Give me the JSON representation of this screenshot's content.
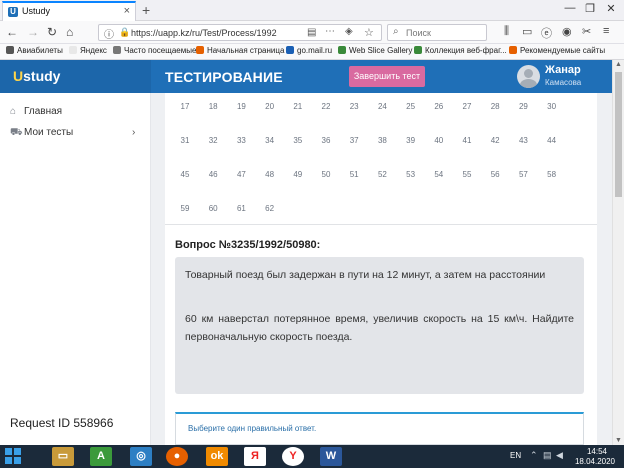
{
  "browser": {
    "tab_title": "Ustudy",
    "url": "https://uapp.kz/ru/Test/Process/1992",
    "search_placeholder": "Поиск",
    "bookmarks": [
      {
        "label": "Авиабилеты",
        "color": "#555555"
      },
      {
        "label": "Яндекс",
        "color": "#e8e8e8"
      },
      {
        "label": "Часто посещаемые",
        "color": "#777777"
      },
      {
        "label": "Начальная страница",
        "color": "#e66000"
      },
      {
        "label": "go.mail.ru",
        "color": "#1a5fb4"
      },
      {
        "label": "Web Slice Gallery",
        "color": "#3a8a3a"
      },
      {
        "label": "Коллекция веб-фраг...",
        "color": "#3a8a3a"
      },
      {
        "label": "Рекомендуемые сайты",
        "color": "#e66000"
      }
    ]
  },
  "header": {
    "logo_initial": "U",
    "logo_rest": "study",
    "page_title": "ТЕСТИРОВАНИЕ",
    "finish_button": "Завершить тест",
    "user_name": "Жанар",
    "user_surname": "Камасова"
  },
  "sidebar": {
    "items": [
      {
        "label": "Главная",
        "icon": "home-icon"
      },
      {
        "label": "Мои тесты",
        "icon": "cart-icon"
      }
    ],
    "request_id": "Request ID 558966"
  },
  "question_numbers": [
    "17",
    "18",
    "19",
    "20",
    "21",
    "22",
    "23",
    "24",
    "25",
    "26",
    "27",
    "28",
    "29",
    "30",
    "31",
    "32",
    "33",
    "34",
    "35",
    "36",
    "37",
    "38",
    "39",
    "40",
    "41",
    "42",
    "43",
    "44",
    "45",
    "46",
    "47",
    "48",
    "49",
    "50",
    "51",
    "52",
    "53",
    "54",
    "55",
    "56",
    "57",
    "58",
    "59",
    "60",
    "61",
    "62"
  ],
  "question": {
    "title": "Вопрос №3235/1992/50980:",
    "text_line1": "Товарный поезд был задержан в пути на 12 минут, а затем на расстоянии",
    "text_line2": "60 км наверстал потерянное время, увеличив скорость на 15 км\\ч. Найдите первоначальную скорость поезда.",
    "answer_prompt": "Выберите один правильный ответ."
  },
  "taskbar": {
    "lang": "EN",
    "time": "14:54",
    "date": "18.04.2020"
  }
}
